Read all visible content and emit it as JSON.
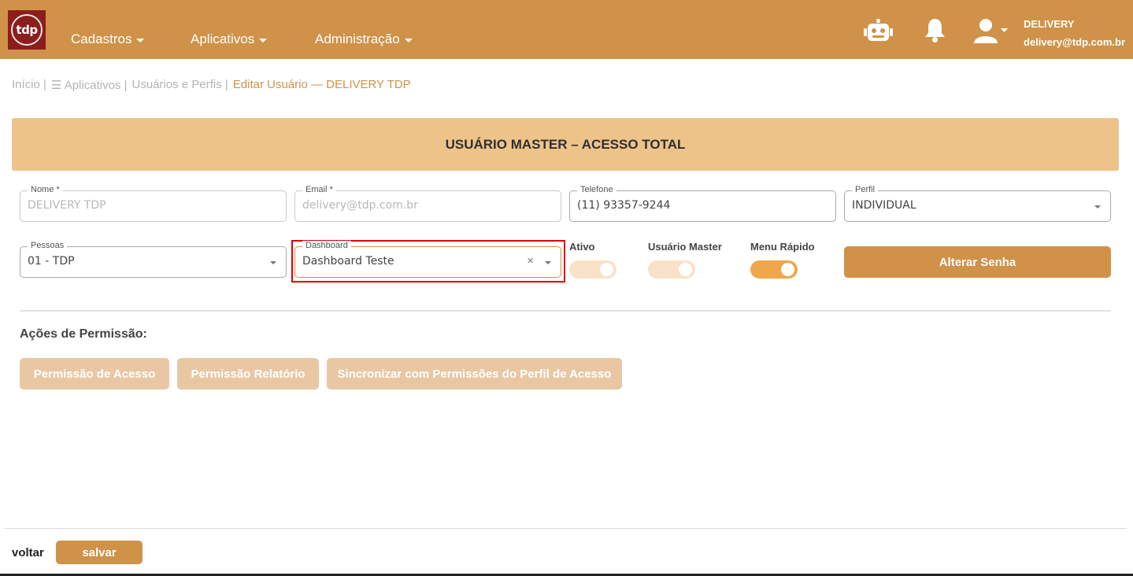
{
  "header": {
    "logo_text": "tdp",
    "nav": [
      {
        "label": "Cadastros"
      },
      {
        "label": "Aplicativos"
      },
      {
        "label": "Administração"
      }
    ],
    "user": {
      "name": "DELIVERY",
      "email": "delivery@tdp.com.br"
    },
    "icons": [
      "robot-icon",
      "bell-icon",
      "user-icon",
      "chevron-down-icon"
    ]
  },
  "breadcrumb": {
    "home": "Início |",
    "apps": "☰ Aplicativos |",
    "users": "Usuários e Perfis |",
    "current": "Editar Usuário — DELIVERY TDP"
  },
  "banner": {
    "title": "USUÁRIO MASTER – ACESSO TOTAL"
  },
  "form": {
    "nome": {
      "label": "Nome *",
      "value": "DELIVERY TDP"
    },
    "email": {
      "label": "Email *",
      "value": "delivery@tdp.com.br"
    },
    "telefone": {
      "label": "Telefone",
      "value": "(11) 93357-9244"
    },
    "perfil": {
      "label": "Perfil",
      "value": "INDIVIDUAL"
    },
    "pessoas": {
      "label": "Pessoas",
      "value": "01 - TDP"
    },
    "dashboard": {
      "label": "Dashboard",
      "value": "Dashboard Teste"
    },
    "ativo": {
      "label": "Ativo",
      "on": false
    },
    "master": {
      "label": "Usuário Master",
      "on": false
    },
    "menu_rapido": {
      "label": "Menu Rápido",
      "on": true
    },
    "alterar_senha": "Alterar Senha"
  },
  "permissions": {
    "title": "Ações de Permissão:",
    "buttons": [
      "Permissão de Acesso",
      "Permissão Relatório",
      "Sincronizar com Permissões do Perfil de Acesso"
    ]
  },
  "footer": {
    "back": "voltar",
    "save": "salvar"
  },
  "colors": {
    "brand": "#cf9248",
    "banner": "#eec38a",
    "highlight": "#e00000"
  }
}
